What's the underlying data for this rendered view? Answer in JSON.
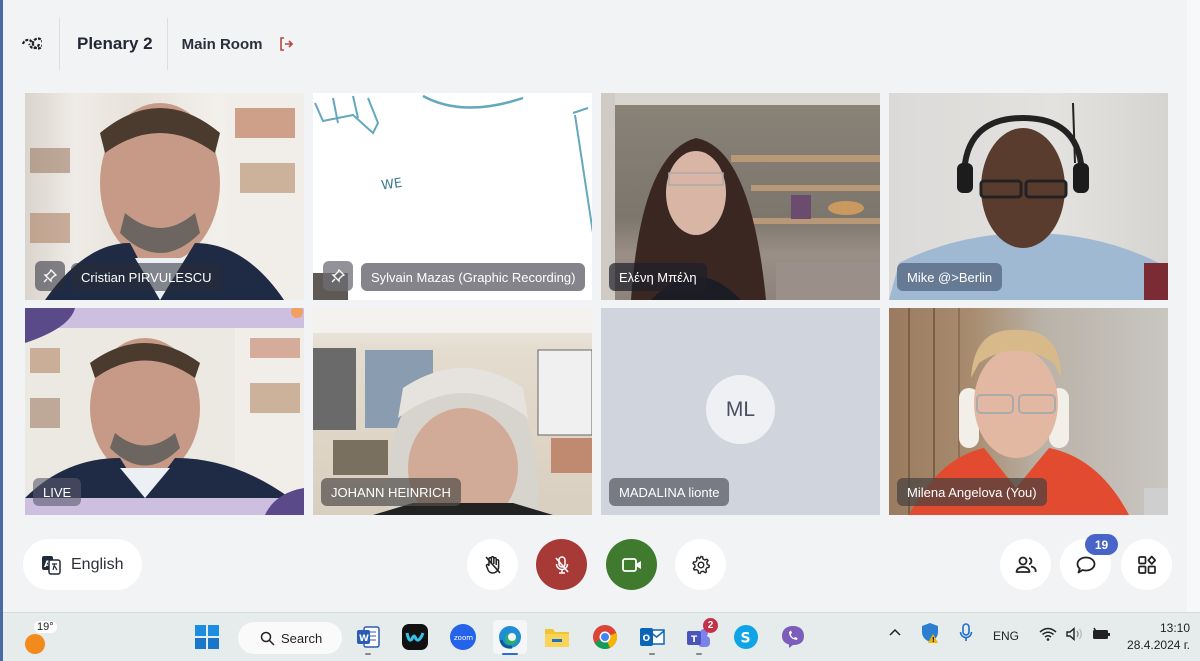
{
  "header": {
    "app_icon": "meeting-logo-icon",
    "title": "Plenary 2",
    "room": "Main Room",
    "leave_icon": "leave-room-icon"
  },
  "tiles": [
    {
      "name": "Cristian PIRVULESCU",
      "pinned": true,
      "type": "video"
    },
    {
      "name": "Sylvain Mazas (Graphic Recording)",
      "pinned": true,
      "type": "video",
      "drawing_text": "WE"
    },
    {
      "name": "Ελένη Μπέλη",
      "pinned": false,
      "type": "video"
    },
    {
      "name": "Mike @>Berlin",
      "pinned": false,
      "type": "video"
    },
    {
      "name": "LIVE",
      "pinned": false,
      "type": "video"
    },
    {
      "name": "JOHANN HEINRICH",
      "pinned": false,
      "type": "video"
    },
    {
      "name": "MADALINA lionte",
      "pinned": false,
      "type": "avatar",
      "initials": "ML"
    },
    {
      "name": "Milena Angelova (You)",
      "pinned": false,
      "type": "video"
    }
  ],
  "controls": {
    "language_label": "English",
    "raise_hand": "raise-hand-off-icon",
    "mic": "mic-muted-icon",
    "camera": "camera-on-icon",
    "settings": "gear-icon",
    "participants": "participants-icon",
    "chat": "chat-icon",
    "chat_unread": "19",
    "apps": "apps-icon",
    "colors": {
      "mic_muted": "#a73a36",
      "camera_on": "#3f7a2f",
      "badge": "#4964c9"
    }
  },
  "taskbar": {
    "weather_temp": "19°",
    "search_label": "Search",
    "apps": [
      {
        "name": "word"
      },
      {
        "name": "webex"
      },
      {
        "name": "zoom",
        "label": "zoom"
      },
      {
        "name": "edge"
      },
      {
        "name": "file-explorer"
      },
      {
        "name": "chrome"
      },
      {
        "name": "outlook"
      },
      {
        "name": "teams",
        "badge": "2"
      },
      {
        "name": "skype"
      },
      {
        "name": "viber"
      }
    ],
    "language": "ENG",
    "time": "13:10",
    "date": "28.4.2024 г."
  }
}
